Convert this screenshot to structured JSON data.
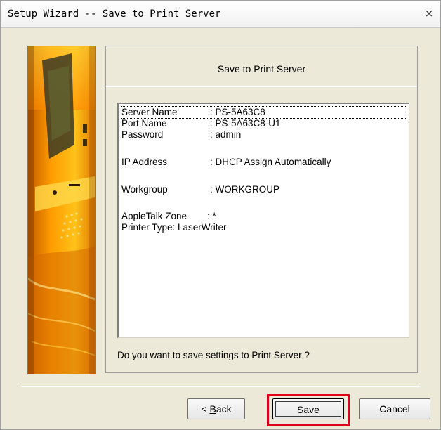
{
  "window": {
    "title": "Setup Wizard -- Save to Print Server",
    "close_glyph": "×"
  },
  "panel": {
    "title": "Save to Print Server",
    "question": "Do you want to save settings to Print Server ?"
  },
  "summary": {
    "server_name": {
      "label": "Server Name",
      "value": ": PS-5A63C8"
    },
    "port_name": {
      "label": "Port Name",
      "value": ": PS-5A63C8-U1"
    },
    "password": {
      "label": "Password",
      "value": ": admin"
    },
    "ip_address": {
      "label": "IP Address",
      "value": ": DHCP Assign Automatically"
    },
    "workgroup": {
      "label": "Workgroup",
      "value": ": WORKGROUP"
    },
    "appletalk_zone": {
      "label": "AppleTalk Zone",
      "value": ": *"
    },
    "printer_type": {
      "text": "Printer Type: LaserWriter"
    }
  },
  "buttons": {
    "back_prefix": "< ",
    "back_underlined": "B",
    "back_rest": "ack",
    "save": "Save",
    "cancel": "Cancel"
  },
  "icons": {
    "close": "close-icon",
    "side_image": "printer-photo-image"
  },
  "colors": {
    "highlight": "#e0001b",
    "dialog_bg": "#ece9d8",
    "image_orange": "#f5a100"
  }
}
